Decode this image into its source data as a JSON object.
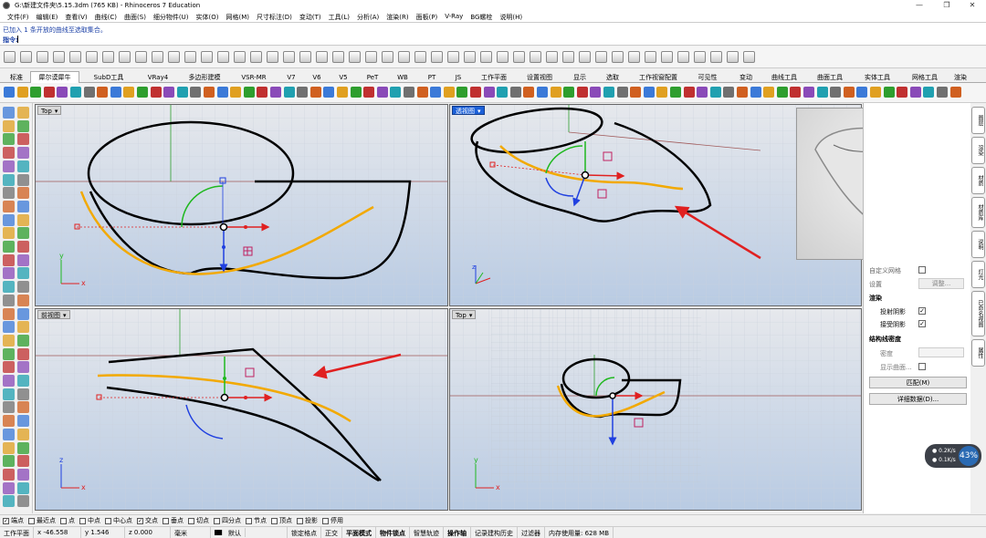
{
  "window": {
    "title": "G:\\新建文件夹\\5.15.3dm (765 KB) - Rhinoceros 7 Education",
    "minimize": "—",
    "maximize": "❐",
    "close": "✕"
  },
  "menu": [
    "文件(F)",
    "编辑(E)",
    "查看(V)",
    "曲线(C)",
    "曲面(S)",
    "细分物件(U)",
    "实体(O)",
    "网格(M)",
    "尺寸标注(D)",
    "变动(T)",
    "工具(L)",
    "分析(A)",
    "渲染(R)",
    "面板(P)",
    "V-Ray",
    "BG螺栓",
    "说明(H)"
  ],
  "command": {
    "history": "已加入 1 条开放的曲线至选取集合。",
    "prompt": "指令:"
  },
  "tabs": [
    "标准",
    "犀尔谟犀牛",
    "SubD工具",
    "VRay4",
    "多边形建模",
    "VSR-MR",
    "V7",
    "V6",
    "V5",
    "PeT",
    "WB",
    "PT",
    "JS",
    "工作平面",
    "设置视图",
    "显示",
    "选取",
    "工作视窗配置",
    "可见性",
    "变动",
    "曲线工具",
    "曲面工具",
    "实体工具",
    "网格工具",
    "渲染"
  ],
  "active_tab": "犀尔谟犀牛",
  "viewports": {
    "top_left": {
      "name": "Top"
    },
    "top_right": {
      "name": "透视图"
    },
    "bottom_left": {
      "name": "前视图"
    },
    "bottom_right": {
      "name": "Top"
    },
    "axis": {
      "x": "x",
      "y": "y",
      "z": "z"
    }
  },
  "panel": {
    "custom_mesh": "自定义网格",
    "settings": "设置",
    "adjust_btn": "调整...",
    "render_head": "渲染",
    "cast_shadows": "投射阴影",
    "receive_shadows": "接受阴影",
    "wire_density_head": "结构线密度",
    "density": "密度",
    "show_surface": "显示曲面...",
    "match_btn": "匹配(M)",
    "details_btn": "详细数据(D)..."
  },
  "side_tabs": [
    "图层",
    "渲染",
    "材质",
    "材质库",
    "说明",
    "灯光",
    "已命名视图",
    "属性"
  ],
  "snaps": [
    {
      "label": "端点",
      "checked": true
    },
    {
      "label": "最近点",
      "checked": false
    },
    {
      "label": "点",
      "checked": false
    },
    {
      "label": "中点",
      "checked": false
    },
    {
      "label": "中心点",
      "checked": false
    },
    {
      "label": "交点",
      "checked": true
    },
    {
      "label": "垂点",
      "checked": false
    },
    {
      "label": "切点",
      "checked": false
    },
    {
      "label": "四分点",
      "checked": false
    },
    {
      "label": "节点",
      "checked": false
    },
    {
      "label": "顶点",
      "checked": false
    },
    {
      "label": "投影",
      "checked": false
    },
    {
      "label": "停用",
      "checked": false
    }
  ],
  "status": {
    "cplane": "工作平面",
    "x": "x -46.558",
    "y": "y 1.546",
    "z": "z 0.000",
    "unit": "毫米",
    "layer": "默认",
    "items": [
      "锁定格点",
      "正交",
      "平面模式",
      "物件锁点",
      "智慧轨迹",
      "操作轴",
      "记录建构历史",
      "过滤器",
      "内存使用量: 628 MB"
    ]
  },
  "perf": {
    "percent": "43%",
    "up": "0.2",
    "down": "0.1",
    "unit": "K/s"
  },
  "colors": {
    "curve": "#000000",
    "accent": "#f2a900",
    "arrow": "#e02020",
    "xaxis": "#e02020",
    "yaxis": "#1fb81f",
    "zaxis": "#2040e0"
  }
}
